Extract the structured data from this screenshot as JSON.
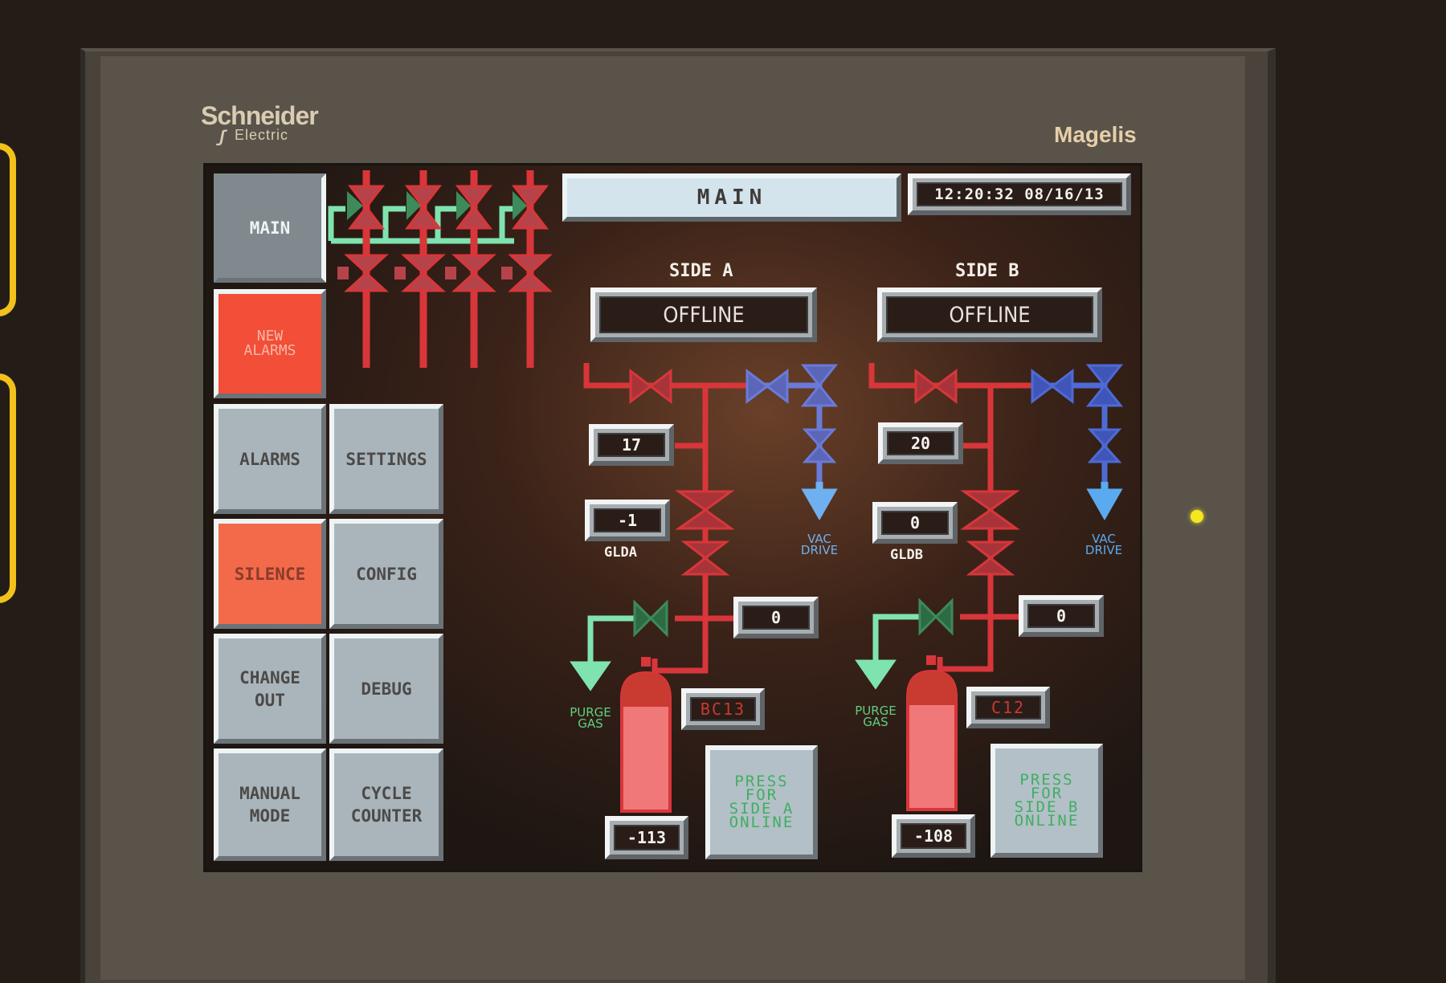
{
  "device": {
    "brand": "Schneider",
    "brand_sub": "Electric",
    "model": "Magelis",
    "status_led_color": "#f4e722"
  },
  "header": {
    "screen_title": "MAIN",
    "clock": "12:20:32 08/16/13"
  },
  "nav": {
    "main": "MAIN",
    "new_alarms": [
      "NEW",
      "ALARMS"
    ],
    "alarms": "ALARMS",
    "settings": "SETTINGS",
    "silence": "SILENCE",
    "config": "CONFIG",
    "change_out": [
      "CHANGE",
      "OUT"
    ],
    "debug": "DEBUG",
    "manual_mode": [
      "MANUAL",
      "MODE"
    ],
    "cycle_counter": [
      "CYCLE",
      "COUNTER"
    ]
  },
  "side_a": {
    "title": "SIDE A",
    "status": "OFFLINE",
    "pressure_top": "17",
    "gld_value": "-1",
    "gld_label": "GLDA",
    "line_value": "0",
    "cylinder_id": "BC13",
    "cylinder_value": "-113",
    "vac_label": [
      "VAC",
      "DRIVE"
    ],
    "purge_label": [
      "PURGE",
      "GAS"
    ],
    "online_button": [
      "PRESS",
      "FOR",
      "SIDE A",
      "ONLINE"
    ]
  },
  "side_b": {
    "title": "SIDE B",
    "status": "OFFLINE",
    "pressure_top": "20",
    "gld_value": "0",
    "gld_label": "GLDB",
    "line_value": "0",
    "cylinder_id": "C12",
    "cylinder_value": "-108",
    "vac_label": [
      "VAC",
      "DRIVE"
    ],
    "purge_label": [
      "PURGE",
      "GAS"
    ],
    "online_button": [
      "PRESS",
      "FOR",
      "SIDE B",
      "ONLINE"
    ]
  },
  "colors": {
    "process_line": "#d8363a",
    "vac_line": "#6a7ad8",
    "purge_line": "#7fe3b0",
    "alarm_red": "#f24e38",
    "button_gray": "#aab5bb"
  }
}
